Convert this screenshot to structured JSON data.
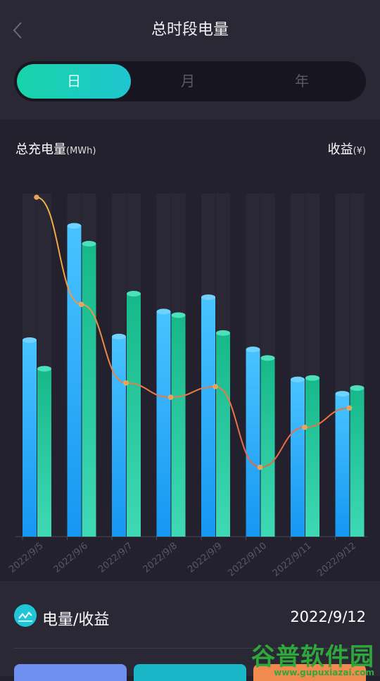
{
  "header": {
    "title": "总时段电量",
    "back_icon": "chevron-left-icon"
  },
  "tabs": [
    {
      "label": "日",
      "active": true
    },
    {
      "label": "月",
      "active": false
    },
    {
      "label": "年",
      "active": false
    }
  ],
  "chart_header": {
    "left_label": "总充电量",
    "left_unit": "(MWh)",
    "right_label": "收益",
    "right_unit": "(¥)"
  },
  "chart_data": {
    "type": "bar",
    "categories": [
      "2022/9/5",
      "2022/9/6",
      "2022/9/7",
      "2022/9/8",
      "2022/9/9",
      "2022/9/10",
      "2022/9/11",
      "2022/9/12"
    ],
    "series": [
      {
        "values": [
          275,
          435,
          280,
          315,
          335,
          262,
          220,
          200
        ],
        "color": "#2aa8f5"
      },
      {
        "values": [
          235,
          410,
          340,
          310,
          285,
          250,
          222,
          208
        ],
        "color": "#1ec39a"
      }
    ],
    "line": {
      "values": [
        475,
        325,
        215,
        195,
        210,
        97,
        153,
        180
      ],
      "color": "#f0a24a"
    },
    "ylim": [
      0,
      480
    ]
  },
  "bottom": {
    "icon": "line-chart-icon",
    "title": "电量/收益",
    "date": "2022/9/12",
    "card_colors": [
      "#6f8ff0",
      "#18b6c6",
      "#f08a4e"
    ]
  },
  "watermark": {
    "text": "谷普软件园",
    "url": "www.gupuxiazai.com"
  }
}
